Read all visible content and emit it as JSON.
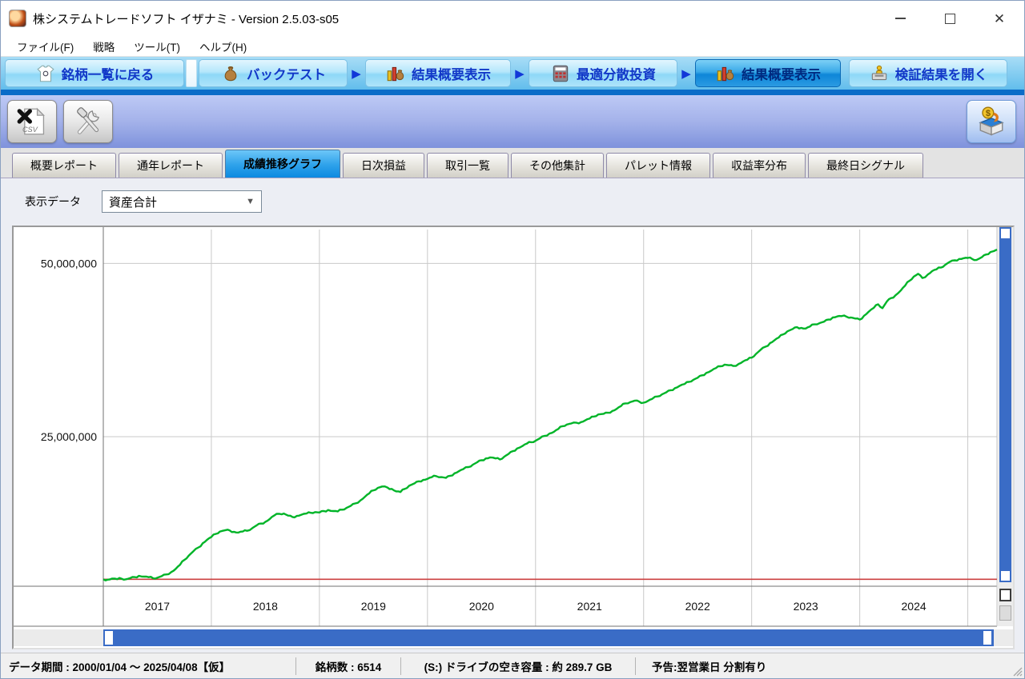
{
  "window": {
    "title": "株システムトレードソフト イザナミ - Version 2.5.03-s05"
  },
  "menu": {
    "items": [
      "ファイル(F)",
      "戦略",
      "ツール(T)",
      "ヘルプ(H)"
    ]
  },
  "nav": {
    "buttons": [
      {
        "label": "銘柄一覧に戻る",
        "icon": "shirt-icon",
        "active": false
      },
      {
        "label": "バックテスト",
        "icon": "sack-icon",
        "active": false
      },
      {
        "label": "結果概要表示",
        "icon": "bar-chart-icon",
        "active": false
      },
      {
        "label": "最適分散投資",
        "icon": "calculator-icon",
        "active": false
      },
      {
        "label": "結果概要表示",
        "icon": "bar-chart-icon",
        "active": true
      },
      {
        "label": "検証結果を開く",
        "icon": "open-results-icon",
        "active": false
      }
    ],
    "arrow_glyph": "▶"
  },
  "toolbar": {
    "csv_label": "CSV",
    "coin_label": "$"
  },
  "tabs": {
    "items": [
      {
        "label": "概要レポート",
        "active": false
      },
      {
        "label": "通年レポート",
        "active": false
      },
      {
        "label": "成績推移グラフ",
        "active": true
      },
      {
        "label": "日次損益",
        "active": false
      },
      {
        "label": "取引一覧",
        "active": false
      },
      {
        "label": "その他集計",
        "active": false
      },
      {
        "label": "パレット情報",
        "active": false
      },
      {
        "label": "収益率分布",
        "active": false
      },
      {
        "label": "最終日シグナル",
        "active": false
      }
    ]
  },
  "controls": {
    "display_data_label": "表示データ",
    "display_data_value": "資産合計"
  },
  "status_bar": {
    "segments": [
      "データ期間 : 2000/01/04 ～ 2025/04/08【仮】",
      "銘柄数 : 6514",
      "(S:) ドライブの空き容量 : 約 289.7 GB",
      "予告:翌営業日 分割有り"
    ]
  },
  "chart_data": {
    "type": "line",
    "value_unit_millions_yen": true,
    "xlim": [
      2017.0,
      2025.27
    ],
    "ylim": [
      3.4,
      54.9
    ],
    "grid_color": "#c9c9c9",
    "frame_color": "#707070",
    "y_ticks": [
      {
        "value": 25,
        "label": "25,000,000"
      },
      {
        "value": 50,
        "label": "50,000,000"
      }
    ],
    "x_gridlines": [
      2018,
      2019,
      2020,
      2021,
      2022,
      2023,
      2024,
      2025
    ],
    "x_band_labels": [
      {
        "label": "2017",
        "center": 2017.5
      },
      {
        "label": "2018",
        "center": 2018.5
      },
      {
        "label": "2019",
        "center": 2019.5
      },
      {
        "label": "2020",
        "center": 2020.5
      },
      {
        "label": "2021",
        "center": 2021.5
      },
      {
        "label": "2022",
        "center": 2022.5
      },
      {
        "label": "2023",
        "center": 2023.5
      },
      {
        "label": "2024",
        "center": 2024.5
      }
    ],
    "baseline": {
      "value": 4.4,
      "color": "#cc4040"
    },
    "series": [
      {
        "name": "資産合計",
        "color": "#00b428",
        "points": [
          [
            2017.0,
            4.4
          ],
          [
            2017.04,
            4.35
          ],
          [
            2017.08,
            4.5
          ],
          [
            2017.13,
            4.42
          ],
          [
            2017.17,
            4.48
          ],
          [
            2017.21,
            4.4
          ],
          [
            2017.25,
            4.58
          ],
          [
            2017.29,
            4.72
          ],
          [
            2017.33,
            4.9
          ],
          [
            2017.38,
            4.78
          ],
          [
            2017.42,
            4.7
          ],
          [
            2017.46,
            4.55
          ],
          [
            2017.5,
            4.62
          ],
          [
            2017.54,
            4.85
          ],
          [
            2017.58,
            5.1
          ],
          [
            2017.63,
            5.45
          ],
          [
            2017.67,
            5.9
          ],
          [
            2017.71,
            6.5
          ],
          [
            2017.75,
            7.2
          ],
          [
            2017.79,
            7.8
          ],
          [
            2017.83,
            8.4
          ],
          [
            2017.88,
            9.0
          ],
          [
            2017.92,
            9.6
          ],
          [
            2017.96,
            10.1
          ],
          [
            2018.0,
            10.5
          ],
          [
            2018.04,
            10.95
          ],
          [
            2018.08,
            11.3
          ],
          [
            2018.13,
            11.5
          ],
          [
            2018.17,
            11.45
          ],
          [
            2018.21,
            11.25
          ],
          [
            2018.25,
            11.15
          ],
          [
            2018.29,
            11.3
          ],
          [
            2018.33,
            11.4
          ],
          [
            2018.38,
            11.8
          ],
          [
            2018.42,
            12.2
          ],
          [
            2018.46,
            12.45
          ],
          [
            2018.5,
            12.7
          ],
          [
            2018.54,
            13.1
          ],
          [
            2018.58,
            13.6
          ],
          [
            2018.63,
            13.85
          ],
          [
            2018.67,
            13.9
          ],
          [
            2018.71,
            13.6
          ],
          [
            2018.75,
            13.4
          ],
          [
            2018.79,
            13.55
          ],
          [
            2018.83,
            13.7
          ],
          [
            2018.88,
            13.9
          ],
          [
            2018.92,
            14.0
          ],
          [
            2018.96,
            14.1
          ],
          [
            2019.0,
            14.05
          ],
          [
            2019.04,
            14.25
          ],
          [
            2019.08,
            14.4
          ],
          [
            2019.13,
            14.25
          ],
          [
            2019.17,
            14.2
          ],
          [
            2019.21,
            14.45
          ],
          [
            2019.25,
            14.7
          ],
          [
            2019.29,
            15.0
          ],
          [
            2019.33,
            15.35
          ],
          [
            2019.38,
            15.8
          ],
          [
            2019.42,
            16.3
          ],
          [
            2019.46,
            16.8
          ],
          [
            2019.5,
            17.25
          ],
          [
            2019.54,
            17.6
          ],
          [
            2019.58,
            17.8
          ],
          [
            2019.63,
            17.65
          ],
          [
            2019.67,
            17.45
          ],
          [
            2019.71,
            17.1
          ],
          [
            2019.75,
            17.0
          ],
          [
            2019.79,
            17.45
          ],
          [
            2019.83,
            17.9
          ],
          [
            2019.88,
            18.25
          ],
          [
            2019.92,
            18.55
          ],
          [
            2019.96,
            18.75
          ],
          [
            2020.0,
            18.9
          ],
          [
            2020.04,
            19.15
          ],
          [
            2020.08,
            19.3
          ],
          [
            2020.13,
            19.15
          ],
          [
            2020.17,
            19.05
          ],
          [
            2020.21,
            19.35
          ],
          [
            2020.25,
            19.7
          ],
          [
            2020.29,
            20.0
          ],
          [
            2020.33,
            20.3
          ],
          [
            2020.38,
            20.6
          ],
          [
            2020.42,
            20.95
          ],
          [
            2020.46,
            21.3
          ],
          [
            2020.5,
            21.6
          ],
          [
            2020.54,
            21.85
          ],
          [
            2020.58,
            22.0
          ],
          [
            2020.63,
            21.85
          ],
          [
            2020.67,
            21.7
          ],
          [
            2020.71,
            22.1
          ],
          [
            2020.75,
            22.5
          ],
          [
            2020.79,
            22.9
          ],
          [
            2020.83,
            23.3
          ],
          [
            2020.88,
            23.65
          ],
          [
            2020.92,
            24.0
          ],
          [
            2020.96,
            24.2
          ],
          [
            2021.0,
            24.4
          ],
          [
            2021.04,
            24.75
          ],
          [
            2021.08,
            25.1
          ],
          [
            2021.13,
            25.45
          ],
          [
            2021.17,
            25.7
          ],
          [
            2021.21,
            26.1
          ],
          [
            2021.25,
            26.5
          ],
          [
            2021.29,
            26.75
          ],
          [
            2021.33,
            26.9
          ],
          [
            2021.38,
            27.0
          ],
          [
            2021.42,
            27.1
          ],
          [
            2021.46,
            27.35
          ],
          [
            2021.5,
            27.6
          ],
          [
            2021.54,
            27.9
          ],
          [
            2021.58,
            28.2
          ],
          [
            2021.63,
            28.3
          ],
          [
            2021.67,
            28.45
          ],
          [
            2021.71,
            28.7
          ],
          [
            2021.75,
            29.0
          ],
          [
            2021.79,
            29.4
          ],
          [
            2021.83,
            29.8
          ],
          [
            2021.88,
            30.0
          ],
          [
            2021.92,
            30.2
          ],
          [
            2021.96,
            30.05
          ],
          [
            2022.0,
            29.9
          ],
          [
            2022.04,
            30.15
          ],
          [
            2022.08,
            30.45
          ],
          [
            2022.13,
            30.8
          ],
          [
            2022.17,
            31.1
          ],
          [
            2022.21,
            31.4
          ],
          [
            2022.25,
            31.7
          ],
          [
            2022.29,
            32.0
          ],
          [
            2022.33,
            32.3
          ],
          [
            2022.38,
            32.6
          ],
          [
            2022.42,
            32.9
          ],
          [
            2022.46,
            33.2
          ],
          [
            2022.5,
            33.5
          ],
          [
            2022.54,
            33.85
          ],
          [
            2022.58,
            34.2
          ],
          [
            2022.63,
            34.55
          ],
          [
            2022.67,
            34.9
          ],
          [
            2022.71,
            35.15
          ],
          [
            2022.75,
            35.4
          ],
          [
            2022.79,
            35.3
          ],
          [
            2022.83,
            35.2
          ],
          [
            2022.88,
            35.5
          ],
          [
            2022.92,
            35.85
          ],
          [
            2022.96,
            36.1
          ],
          [
            2023.0,
            36.4
          ],
          [
            2023.04,
            36.95
          ],
          [
            2023.08,
            37.5
          ],
          [
            2023.13,
            38.0
          ],
          [
            2023.17,
            38.5
          ],
          [
            2023.21,
            38.9
          ],
          [
            2023.25,
            39.3
          ],
          [
            2023.29,
            39.75
          ],
          [
            2023.33,
            40.2
          ],
          [
            2023.38,
            40.55
          ],
          [
            2023.42,
            40.8
          ],
          [
            2023.46,
            40.7
          ],
          [
            2023.5,
            40.6
          ],
          [
            2023.54,
            40.9
          ],
          [
            2023.58,
            41.2
          ],
          [
            2023.63,
            41.4
          ],
          [
            2023.67,
            41.6
          ],
          [
            2023.71,
            41.9
          ],
          [
            2023.75,
            42.2
          ],
          [
            2023.79,
            42.35
          ],
          [
            2023.83,
            42.4
          ],
          [
            2023.88,
            42.3
          ],
          [
            2023.92,
            42.2
          ],
          [
            2023.96,
            42.05
          ],
          [
            2024.0,
            41.9
          ],
          [
            2024.04,
            42.45
          ],
          [
            2024.08,
            43.0
          ],
          [
            2024.13,
            43.6
          ],
          [
            2024.17,
            44.1
          ],
          [
            2024.21,
            43.55
          ],
          [
            2024.25,
            44.5
          ],
          [
            2024.29,
            45.0
          ],
          [
            2024.33,
            45.4
          ],
          [
            2024.38,
            46.1
          ],
          [
            2024.42,
            46.8
          ],
          [
            2024.46,
            47.5
          ],
          [
            2024.5,
            48.1
          ],
          [
            2024.54,
            48.5
          ],
          [
            2024.58,
            47.9
          ],
          [
            2024.63,
            48.4
          ],
          [
            2024.67,
            48.9
          ],
          [
            2024.71,
            49.15
          ],
          [
            2024.75,
            49.4
          ],
          [
            2024.79,
            49.8
          ],
          [
            2024.83,
            50.2
          ],
          [
            2024.88,
            50.45
          ],
          [
            2024.92,
            50.65
          ],
          [
            2024.96,
            50.75
          ],
          [
            2025.0,
            50.8
          ],
          [
            2025.04,
            50.65
          ],
          [
            2025.08,
            50.5
          ],
          [
            2025.13,
            50.9
          ],
          [
            2025.17,
            51.3
          ],
          [
            2025.21,
            51.65
          ],
          [
            2025.27,
            52.0
          ]
        ]
      }
    ]
  }
}
